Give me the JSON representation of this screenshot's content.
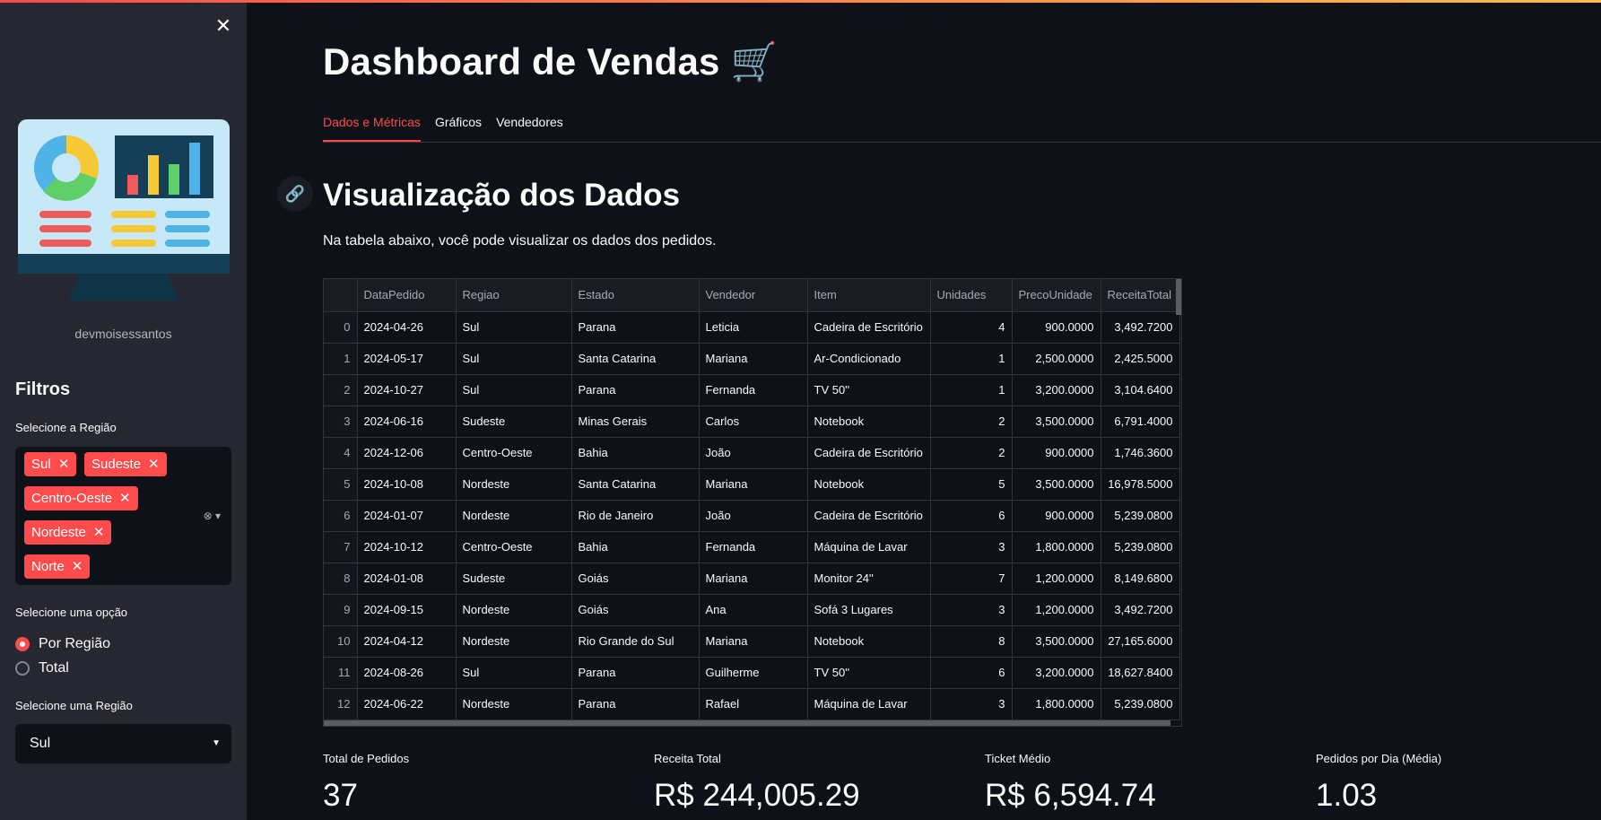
{
  "sidebar": {
    "close_icon": "close-icon",
    "caption": "devmoisessantos",
    "filters_title": "Filtros",
    "region_label": "Selecione a Região",
    "regions": [
      "Sul",
      "Sudeste",
      "Centro-Oeste",
      "Nordeste",
      "Norte"
    ],
    "option_label": "Selecione uma opção",
    "options": [
      "Por Região",
      "Total"
    ],
    "selected_option": "Por Região",
    "single_region_label": "Selecione uma Região",
    "single_region_value": "Sul"
  },
  "header": {
    "title": "Dashboard de Vendas 🛒",
    "tabs": [
      "Dados e Métricas",
      "Gráficos",
      "Vendedores"
    ],
    "active_tab": "Dados e Métricas"
  },
  "section": {
    "title": "Visualização dos Dados",
    "description": "Na tabela abaixo, você pode visualizar os dados dos pedidos."
  },
  "table": {
    "columns": [
      "",
      "DataPedido",
      "Regiao",
      "Estado",
      "Vendedor",
      "Item",
      "Unidades",
      "PrecoUnidade",
      "ReceitaTotal"
    ],
    "rows": [
      [
        "0",
        "2024-04-26",
        "Sul",
        "Parana",
        "Leticia",
        "Cadeira de Escritório",
        "4",
        "900.0000",
        "3,492.7200"
      ],
      [
        "1",
        "2024-05-17",
        "Sul",
        "Santa Catarina",
        "Mariana",
        "Ar-Condicionado",
        "1",
        "2,500.0000",
        "2,425.5000"
      ],
      [
        "2",
        "2024-10-27",
        "Sul",
        "Parana",
        "Fernanda",
        "TV 50''",
        "1",
        "3,200.0000",
        "3,104.6400"
      ],
      [
        "3",
        "2024-06-16",
        "Sudeste",
        "Minas Gerais",
        "Carlos",
        "Notebook",
        "2",
        "3,500.0000",
        "6,791.4000"
      ],
      [
        "4",
        "2024-12-06",
        "Centro-Oeste",
        "Bahia",
        "João",
        "Cadeira de Escritório",
        "2",
        "900.0000",
        "1,746.3600"
      ],
      [
        "5",
        "2024-10-08",
        "Nordeste",
        "Santa Catarina",
        "Mariana",
        "Notebook",
        "5",
        "3,500.0000",
        "16,978.5000"
      ],
      [
        "6",
        "2024-01-07",
        "Nordeste",
        "Rio de Janeiro",
        "João",
        "Cadeira de Escritório",
        "6",
        "900.0000",
        "5,239.0800"
      ],
      [
        "7",
        "2024-10-12",
        "Centro-Oeste",
        "Bahia",
        "Fernanda",
        "Máquina de Lavar",
        "3",
        "1,800.0000",
        "5,239.0800"
      ],
      [
        "8",
        "2024-01-08",
        "Sudeste",
        "Goiás",
        "Mariana",
        "Monitor 24''",
        "7",
        "1,200.0000",
        "8,149.6800"
      ],
      [
        "9",
        "2024-09-15",
        "Nordeste",
        "Goiás",
        "Ana",
        "Sofá 3 Lugares",
        "3",
        "1,200.0000",
        "3,492.7200"
      ],
      [
        "10",
        "2024-04-12",
        "Nordeste",
        "Rio Grande do Sul",
        "Mariana",
        "Notebook",
        "8",
        "3,500.0000",
        "27,165.6000"
      ],
      [
        "11",
        "2024-08-26",
        "Sul",
        "Parana",
        "Guilherme",
        "TV 50''",
        "6",
        "3,200.0000",
        "18,627.8400"
      ],
      [
        "12",
        "2024-06-22",
        "Nordeste",
        "Parana",
        "Rafael",
        "Máquina de Lavar",
        "3",
        "1,800.0000",
        "5,239.0800"
      ]
    ]
  },
  "metrics": [
    {
      "label": "Total de Pedidos",
      "value": "37"
    },
    {
      "label": "Receita Total",
      "value": "R$ 244,005.29"
    },
    {
      "label": "Ticket Médio",
      "value": "R$ 6,594.74"
    },
    {
      "label": "Pedidos por Dia (Média)",
      "value": "1.03"
    }
  ],
  "colors": {
    "accent": "#ff4b4b",
    "sidebar_bg": "#262730",
    "main_bg": "#0e1117"
  }
}
